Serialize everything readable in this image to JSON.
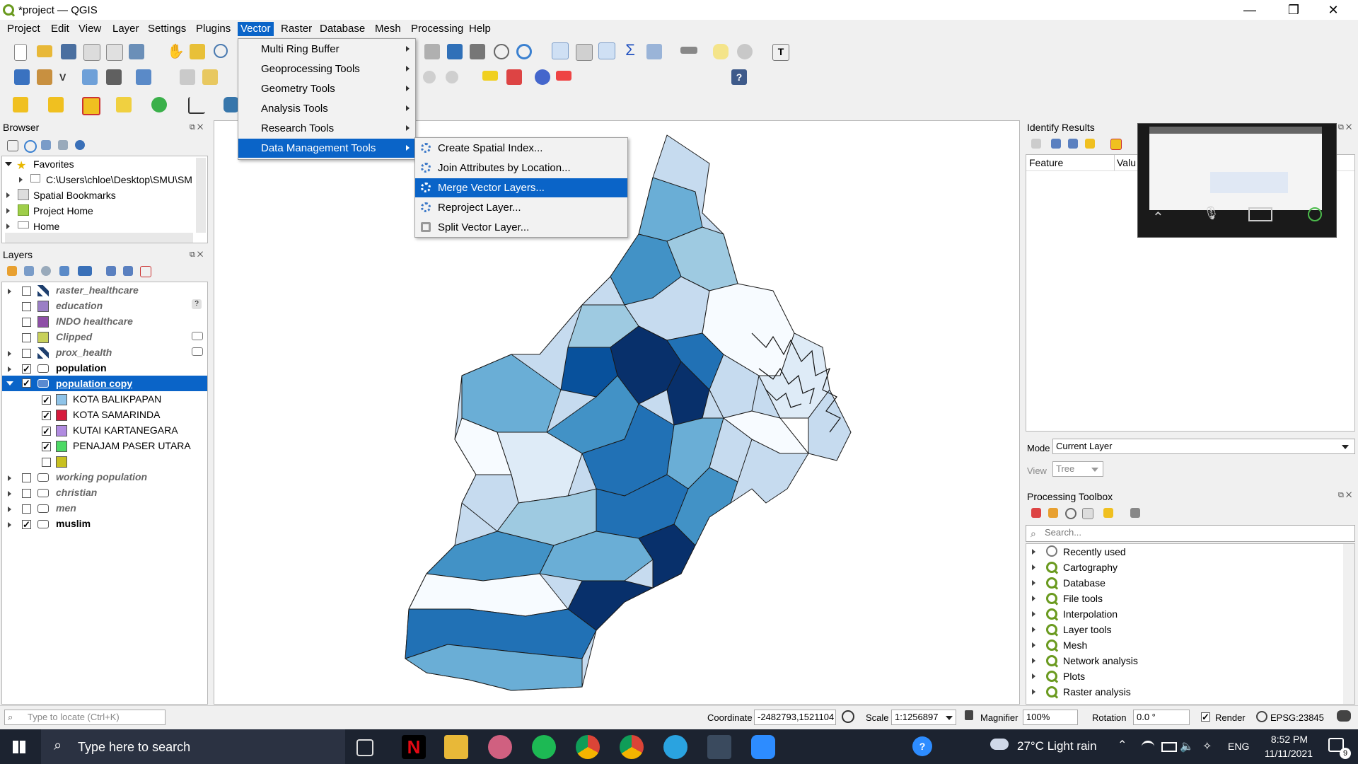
{
  "window": {
    "title": "*project — QGIS",
    "minimize": "—",
    "restore": "❐",
    "close": "✕"
  },
  "menubar": [
    "Project",
    "Edit",
    "View",
    "Layer",
    "Settings",
    "Plugins",
    "Vector",
    "Raster",
    "Database",
    "Mesh",
    "Processing",
    "Help"
  ],
  "vector_menu": {
    "items": [
      "Multi Ring Buffer",
      "Geoprocessing Tools",
      "Geometry Tools",
      "Analysis Tools",
      "Research Tools",
      "Data Management Tools"
    ],
    "active": "Data Management Tools"
  },
  "data_management_menu": {
    "items": [
      "Create Spatial Index...",
      "Join Attributes by Location...",
      "Merge Vector Layers...",
      "Reproject Layer...",
      "Split Vector Layer..."
    ],
    "highlighted": "Merge Vector Layers..."
  },
  "browser": {
    "title": "Browser",
    "items": [
      "Favorites",
      "C:\\Users\\chloe\\Desktop\\SMU\\SM",
      "Spatial Bookmarks",
      "Project Home",
      "Home"
    ]
  },
  "layers": {
    "title": "Layers",
    "items": [
      {
        "name": "raster_healthcare",
        "checked": false
      },
      {
        "name": "education",
        "checked": false
      },
      {
        "name": "INDO healthcare",
        "checked": false
      },
      {
        "name": "Clipped",
        "checked": false
      },
      {
        "name": "prox_health",
        "checked": false
      },
      {
        "name": "population",
        "checked": true
      },
      {
        "name": "population copy",
        "checked": true
      }
    ],
    "categories": [
      {
        "label": "KOTA BALIKPAPAN",
        "color": "#8ec3e8"
      },
      {
        "label": "KOTA SAMARINDA",
        "color": "#d61a3c"
      },
      {
        "label": "KUTAI KARTANEGARA",
        "color": "#b08be0"
      },
      {
        "label": "PENAJAM PASER UTARA",
        "color": "#4cd964"
      },
      {
        "label": "",
        "color": "#c8c020"
      }
    ],
    "more": [
      {
        "name": "working population",
        "checked": false
      },
      {
        "name": "christian",
        "checked": false
      },
      {
        "name": "men",
        "checked": false
      },
      {
        "name": "muslim",
        "checked": true
      }
    ]
  },
  "identify": {
    "title": "Identify Results",
    "col_feature": "Feature",
    "col_value": "Valu",
    "mode_label": "Mode",
    "mode_value": "Current Layer",
    "view_label": "View",
    "view_value": "Tree"
  },
  "toolbox": {
    "title": "Processing Toolbox",
    "search_placeholder": "Search...",
    "items": [
      "Recently used",
      "Cartography",
      "Database",
      "File tools",
      "Interpolation",
      "Layer tools",
      "Mesh",
      "Network analysis",
      "Plots",
      "Raster analysis"
    ]
  },
  "statusbar": {
    "locate_placeholder": "Type to locate (Ctrl+K)",
    "coordinate_label": "Coordinate",
    "coordinate_value": "-2482793,1521104",
    "scale_label": "Scale",
    "scale_value": "1:1256897",
    "magnifier_label": "Magnifier",
    "magnifier_value": "100%",
    "rotation_label": "Rotation",
    "rotation_value": "0.0 °",
    "render_label": "Render",
    "crs": "EPSG:23845"
  },
  "taskbar": {
    "search_placeholder": "Type here to search",
    "weather": "27°C  Light rain",
    "lang": "ENG",
    "time": "8:52 PM",
    "date": "11/11/2021",
    "notif_count": "9"
  },
  "colors": {
    "accent": "#0a64c8",
    "map_dark": "#08306b",
    "map_mid": "#2b7bba",
    "map_light": "#c6dbef"
  }
}
